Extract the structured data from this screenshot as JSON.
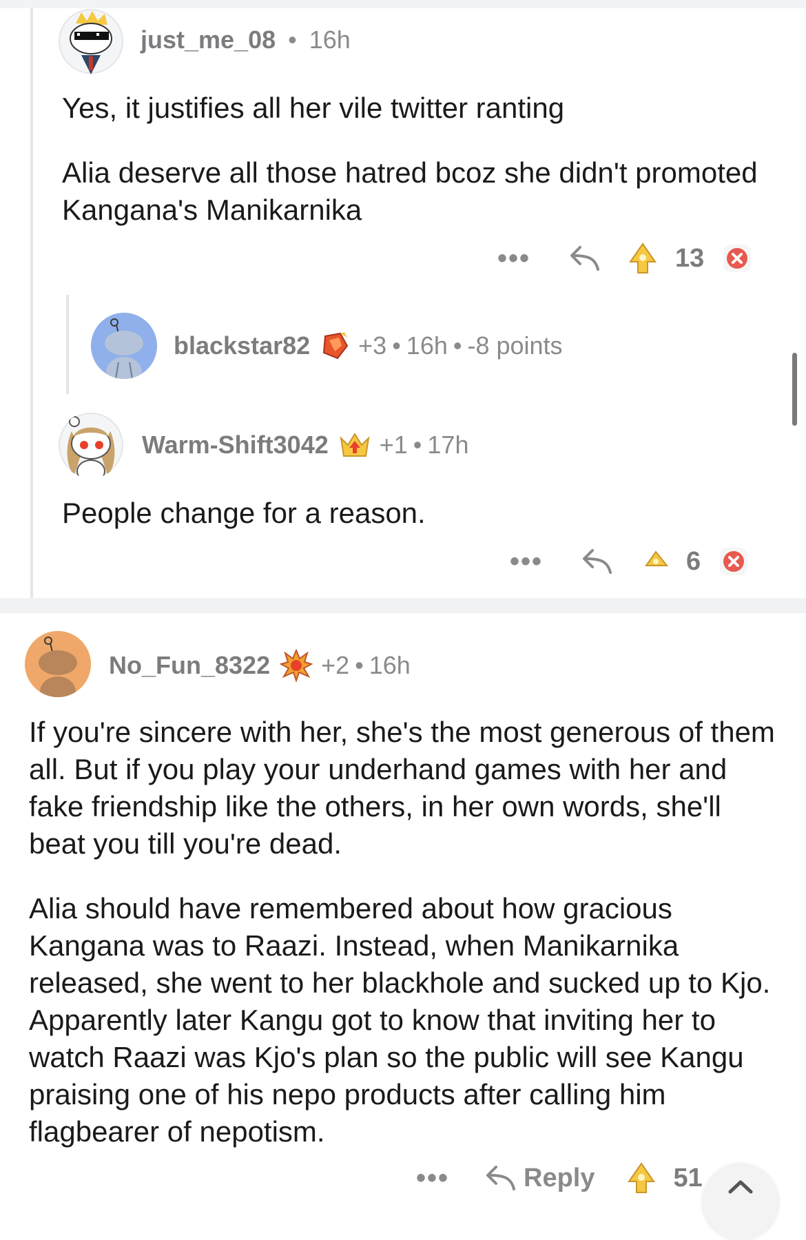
{
  "comments": [
    {
      "username": "just_me_08",
      "time": "16h",
      "paragraphs": [
        "Yes, it justifies all her vile twitter ranting",
        "Alia deserve all those hatred bcoz she didn't promoted Kangana's Manikarnika"
      ],
      "more": "•••",
      "votes": "13"
    },
    {
      "username": "blackstar82",
      "karma": "+3",
      "time": "16h",
      "points": "-8 points"
    },
    {
      "username": "Warm-Shift3042",
      "karma": "+1",
      "time": "17h",
      "paragraphs": [
        "People change for a reason."
      ],
      "more": "•••",
      "votes": "6"
    },
    {
      "username": "No_Fun_8322",
      "karma": "+2",
      "time": "16h",
      "paragraphs": [
        "If you're sincere with her, she's the most generous of them all. But if you play your underhand games with her and fake friendship like the others, in her own words, she'll beat you till you're dead.",
        "Alia should have remembered about how gracious Kangana was to Raazi. Instead, when Manikarnika released, she went to her blackhole and sucked up to Kjo. Apparently later Kangu got to know that inviting her to watch Raazi was Kjo's plan so the public will see Kangu praising one of his nepo products after calling him flagbearer of nepotism."
      ],
      "more": "•••",
      "reply_label": "Reply",
      "votes": "51"
    }
  ],
  "separator": "•",
  "colors": {
    "text": "#1a1a1b",
    "meta": "#8a8a8d",
    "downvote": "#e8594f",
    "upvote_award": "#f2c744",
    "avatar_blue": "#8fb0ea",
    "avatar_orange": "#f0a86a"
  },
  "icons": [
    "snoo-avatar-icon",
    "blue-snoo-avatar-icon",
    "snoo-girl-avatar-icon",
    "orange-snoo-avatar-icon",
    "ruby-award-icon",
    "crown-award-icon",
    "explosion-award-icon",
    "reply-arrow-icon",
    "upvote-award-icon",
    "downvote-x-icon",
    "scroll-to-top-icon"
  ]
}
